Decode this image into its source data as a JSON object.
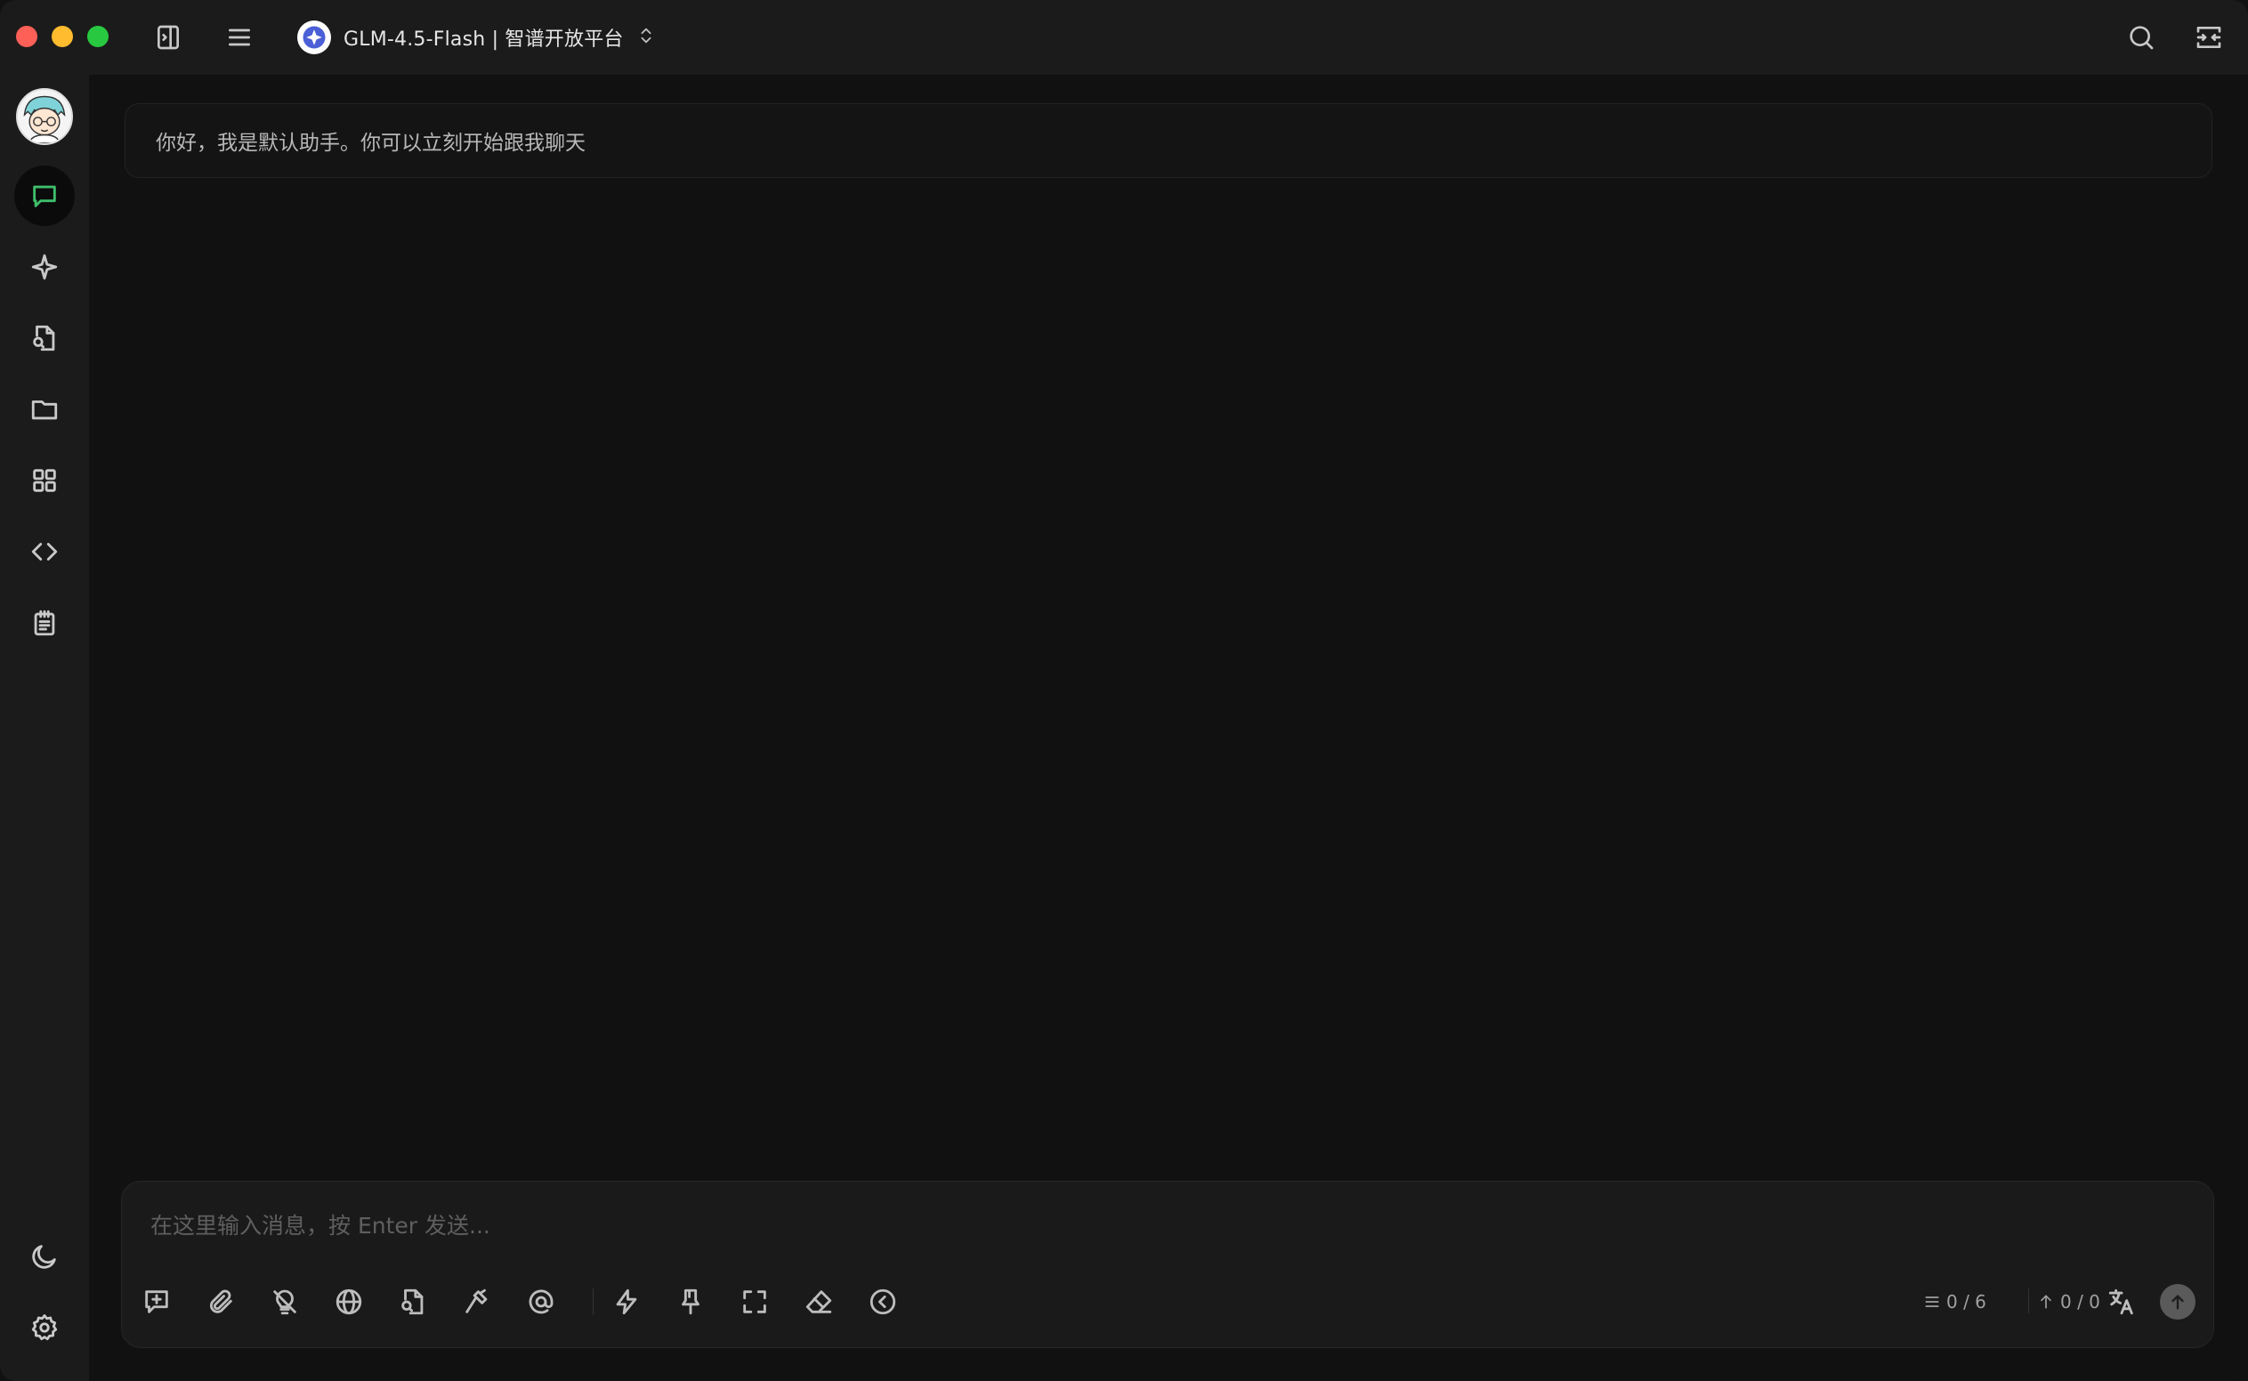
{
  "titlebar": {
    "model_name": "GLM-4.5-Flash | 智谱开放平台",
    "icons": [
      "sidebar-toggle-icon",
      "menu-icon",
      "model-logo-icon",
      "chevron-updown-icon",
      "search-icon",
      "expand-icon"
    ]
  },
  "sidebar": {
    "items": [
      {
        "id": "chat",
        "icon": "chat-bubble-icon",
        "active": true
      },
      {
        "id": "agents",
        "icon": "sparkle-icon",
        "active": false
      },
      {
        "id": "doc-search",
        "icon": "file-search-icon",
        "active": false
      },
      {
        "id": "files",
        "icon": "folder-icon",
        "active": false
      },
      {
        "id": "apps",
        "icon": "grid-icon",
        "active": false
      },
      {
        "id": "code",
        "icon": "code-icon",
        "active": false
      },
      {
        "id": "notes",
        "icon": "notepad-icon",
        "active": false
      }
    ],
    "bottom": [
      "moon-icon",
      "gear-icon"
    ]
  },
  "chat": {
    "welcome_message": "你好，我是默认助手。你可以立刻开始跟我聊天"
  },
  "composer": {
    "placeholder": "在这里输入消息，按 Enter 发送...",
    "value": "",
    "context_count": "0 / 6",
    "token_count": "0 / 0",
    "tools": [
      "new-topic-icon",
      "attachment-icon",
      "thinking-off-icon",
      "web-search-icon",
      "knowledge-base-icon",
      "tools-icon",
      "mention-icon",
      "quick-phrase-icon",
      "pin-icon",
      "fullscreen-icon",
      "clear-icon",
      "collapse-icon",
      "translate-icon",
      "send-icon"
    ]
  },
  "colors": {
    "accent_green": "#3fbf6c",
    "background": "#111111",
    "panel": "#1b1b1b",
    "close": "#fe5f57",
    "minimize": "#febc2e",
    "maximize": "#28c840"
  }
}
